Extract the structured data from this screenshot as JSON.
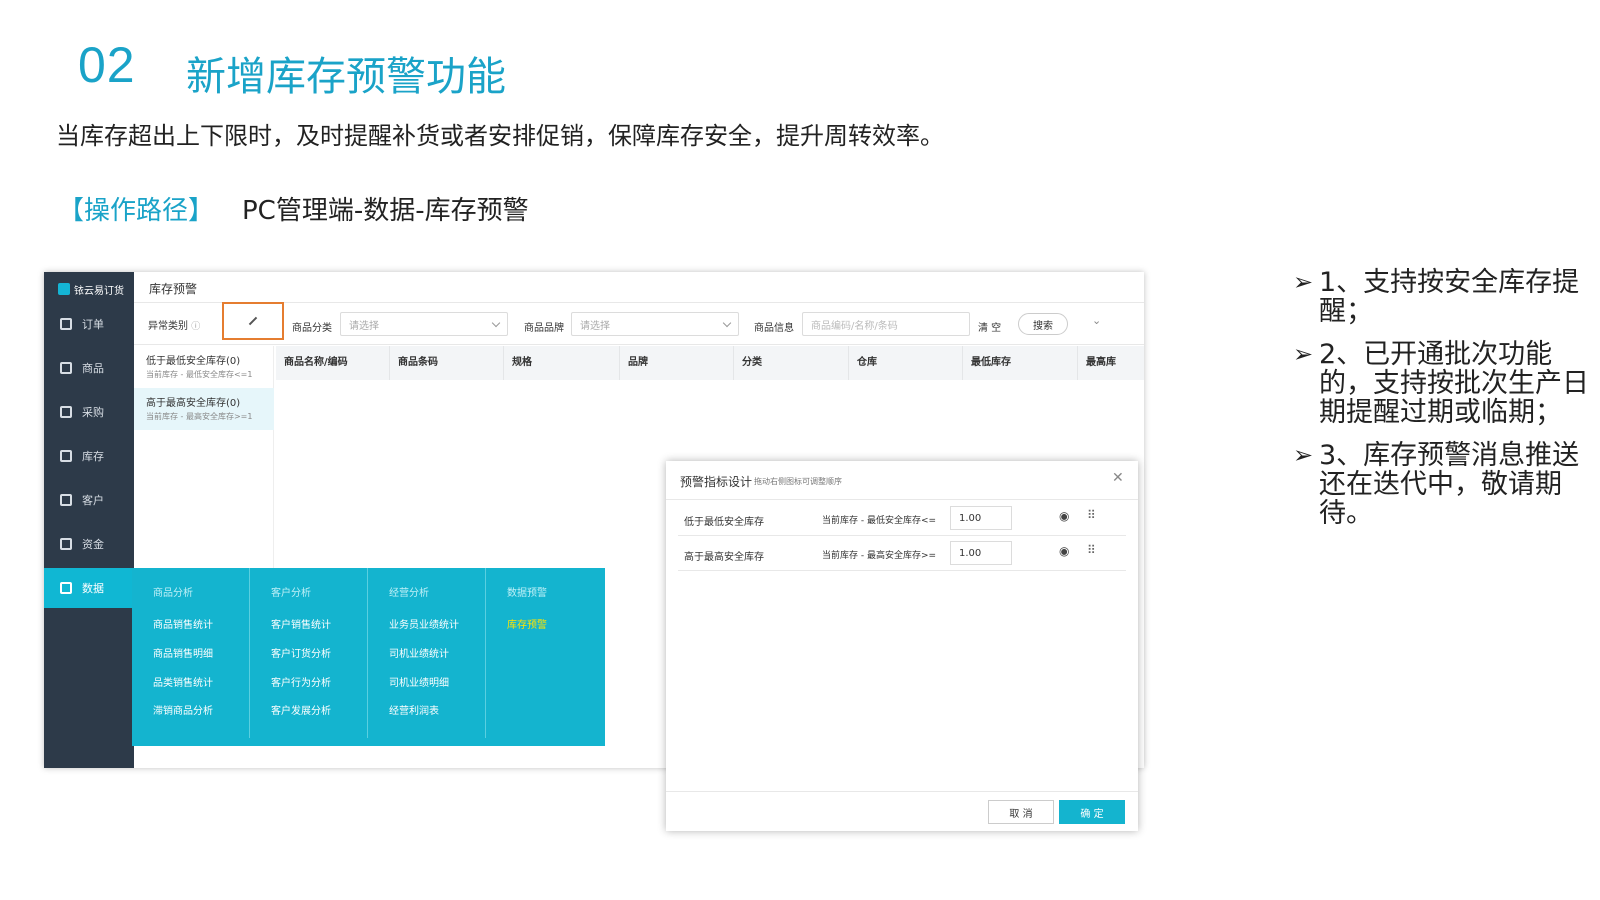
{
  "slide": {
    "number": "02",
    "title": "新增库存预警功能",
    "subtitle": "当库存超出上下限时，及时提醒补货或者安排促销，保障库存安全，提升周转效率。",
    "path_label": "【操作路径】",
    "path_value": "PC管理端-数据-库存预警"
  },
  "bullets": [
    "1、支持按安全库存提醒；",
    "2、已开通批次功能的，支持按批次生产日期提醒过期或临期；",
    "3、库存预警消息推送还在迭代中，敬请期待。"
  ],
  "app": {
    "brand": "铱云易订货",
    "nav": [
      {
        "label": "订单",
        "icon": "clipboard-icon"
      },
      {
        "label": "商品",
        "icon": "box-icon"
      },
      {
        "label": "采购",
        "icon": "basket-icon"
      },
      {
        "label": "库存",
        "icon": "warehouse-icon"
      },
      {
        "label": "客户",
        "icon": "user-icon"
      },
      {
        "label": "资金",
        "icon": "shield-icon"
      },
      {
        "label": "数据",
        "icon": "chart-icon",
        "active": true
      }
    ],
    "page_title": "库存预警",
    "filters": {
      "anomaly_type": "异常类别",
      "category_label": "商品分类",
      "category_placeholder": "请选择",
      "brand_label": "商品品牌",
      "brand_placeholder": "请选择",
      "info_label": "商品信息",
      "info_placeholder": "商品编码/名称/条码",
      "clear": "清 空",
      "search": "搜索"
    },
    "anomaly_list": [
      {
        "title": "低于最低安全库存(0)",
        "desc": "当前库存 - 最低安全库存<=1",
        "selected": false
      },
      {
        "title": "高于最高安全库存(0)",
        "desc": "当前库存 - 最高安全库存>=1",
        "selected": true
      }
    ],
    "table_columns": [
      "商品名称/编码",
      "商品条码",
      "规格",
      "品牌",
      "分类",
      "仓库",
      "最低库存",
      "最高库"
    ],
    "data_menu": {
      "columns": [
        {
          "header": "商品分析",
          "items": [
            "商品销售统计",
            "商品销售明细",
            "品类销售统计",
            "滞销商品分析"
          ]
        },
        {
          "header": "客户分析",
          "items": [
            "客户销售统计",
            "客户订货分析",
            "客户行为分析",
            "客户发展分析"
          ]
        },
        {
          "header": "经营分析",
          "items": [
            "业务员业绩统计",
            "司机业绩统计",
            "司机业绩明细",
            "经营利润表"
          ]
        },
        {
          "header": "数据预警",
          "items": [
            "库存预警"
          ]
        }
      ],
      "highlight_color": "#ffe400"
    }
  },
  "dialog": {
    "title": "预警指标设计",
    "hint": "拖动右侧图标可调整顺序",
    "rows": [
      {
        "label": "低于最低安全库存",
        "condition": "当前库存 - 最低安全库存<=",
        "value": "1.00"
      },
      {
        "label": "高于最高安全库存",
        "condition": "当前库存 - 最高安全库存>=",
        "value": "1.00"
      }
    ],
    "cancel": "取 消",
    "confirm": "确 定"
  },
  "colors": {
    "accent": "#1aa3c8",
    "sidebar": "#2d3a49",
    "menu_teal": "#14b4cf",
    "highlight_box": "#e57d30"
  }
}
